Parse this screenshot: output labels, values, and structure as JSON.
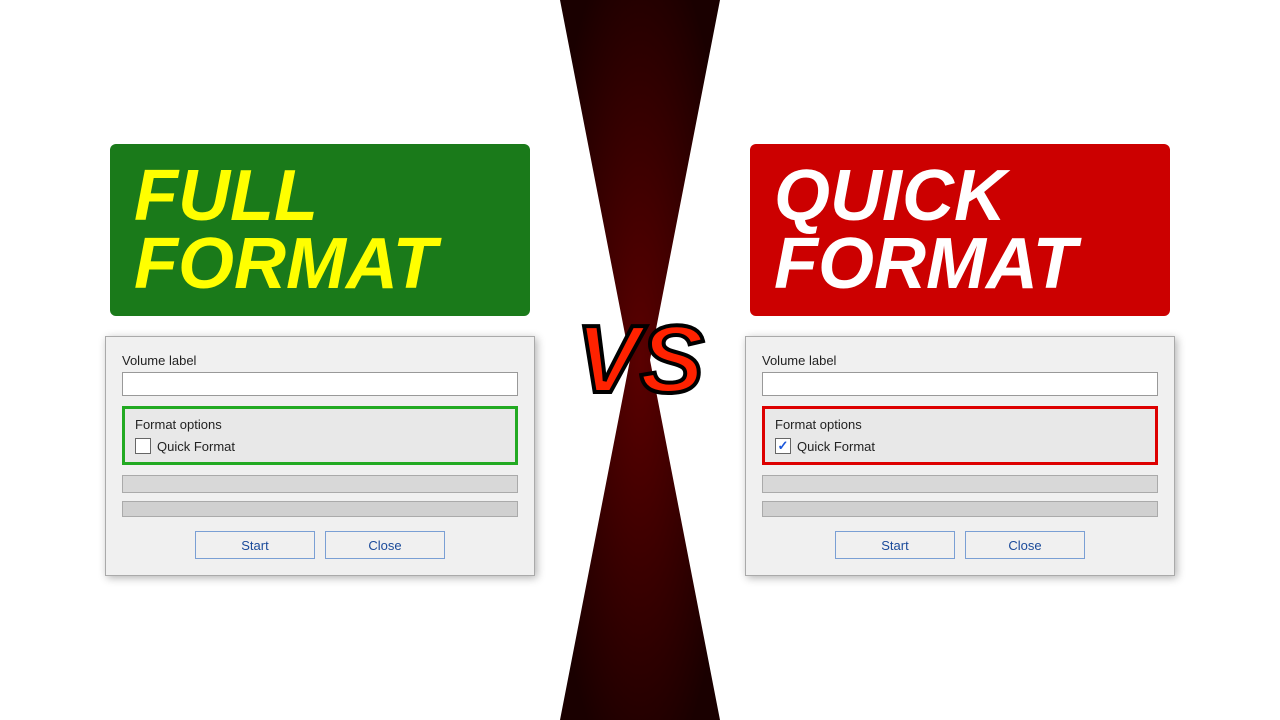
{
  "left": {
    "banner_text_line1": "FULL",
    "banner_text_line2": "FORMAT",
    "dialog": {
      "volume_label": "Volume label",
      "input_value": "",
      "format_options_heading": "Format options",
      "quick_format_label": "Quick Format",
      "quick_format_checked": false,
      "start_btn": "Start",
      "close_btn": "Close"
    }
  },
  "right": {
    "banner_text_line1": "QUICK",
    "banner_text_line2": "FORMAT",
    "dialog": {
      "volume_label": "Volume label",
      "input_value": "",
      "format_options_heading": "Format options",
      "quick_format_label": "Quick Format",
      "quick_format_checked": true,
      "start_btn": "Start",
      "close_btn": "Close"
    }
  },
  "vs_text": "VS"
}
